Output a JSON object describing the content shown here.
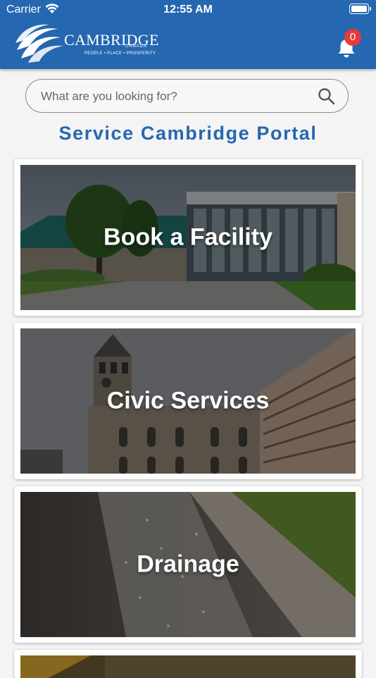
{
  "status": {
    "carrier": "Carrier",
    "time": "12:55 AM"
  },
  "header": {
    "logo": {
      "word": "CAMBRIDGE",
      "country": "CANADA",
      "tagline": "PEOPLE • PLACE • PROSPERITY"
    },
    "notifications": {
      "count": "0"
    }
  },
  "search": {
    "placeholder": "What are you looking for?"
  },
  "portal": {
    "title": "Service Cambridge Portal"
  },
  "cards": [
    {
      "label": "Book a Facility"
    },
    {
      "label": "Civic Services"
    },
    {
      "label": "Drainage"
    }
  ],
  "colors": {
    "brand": "#2567b0",
    "badge": "#e73a3a",
    "background": "#f4f4f5"
  }
}
